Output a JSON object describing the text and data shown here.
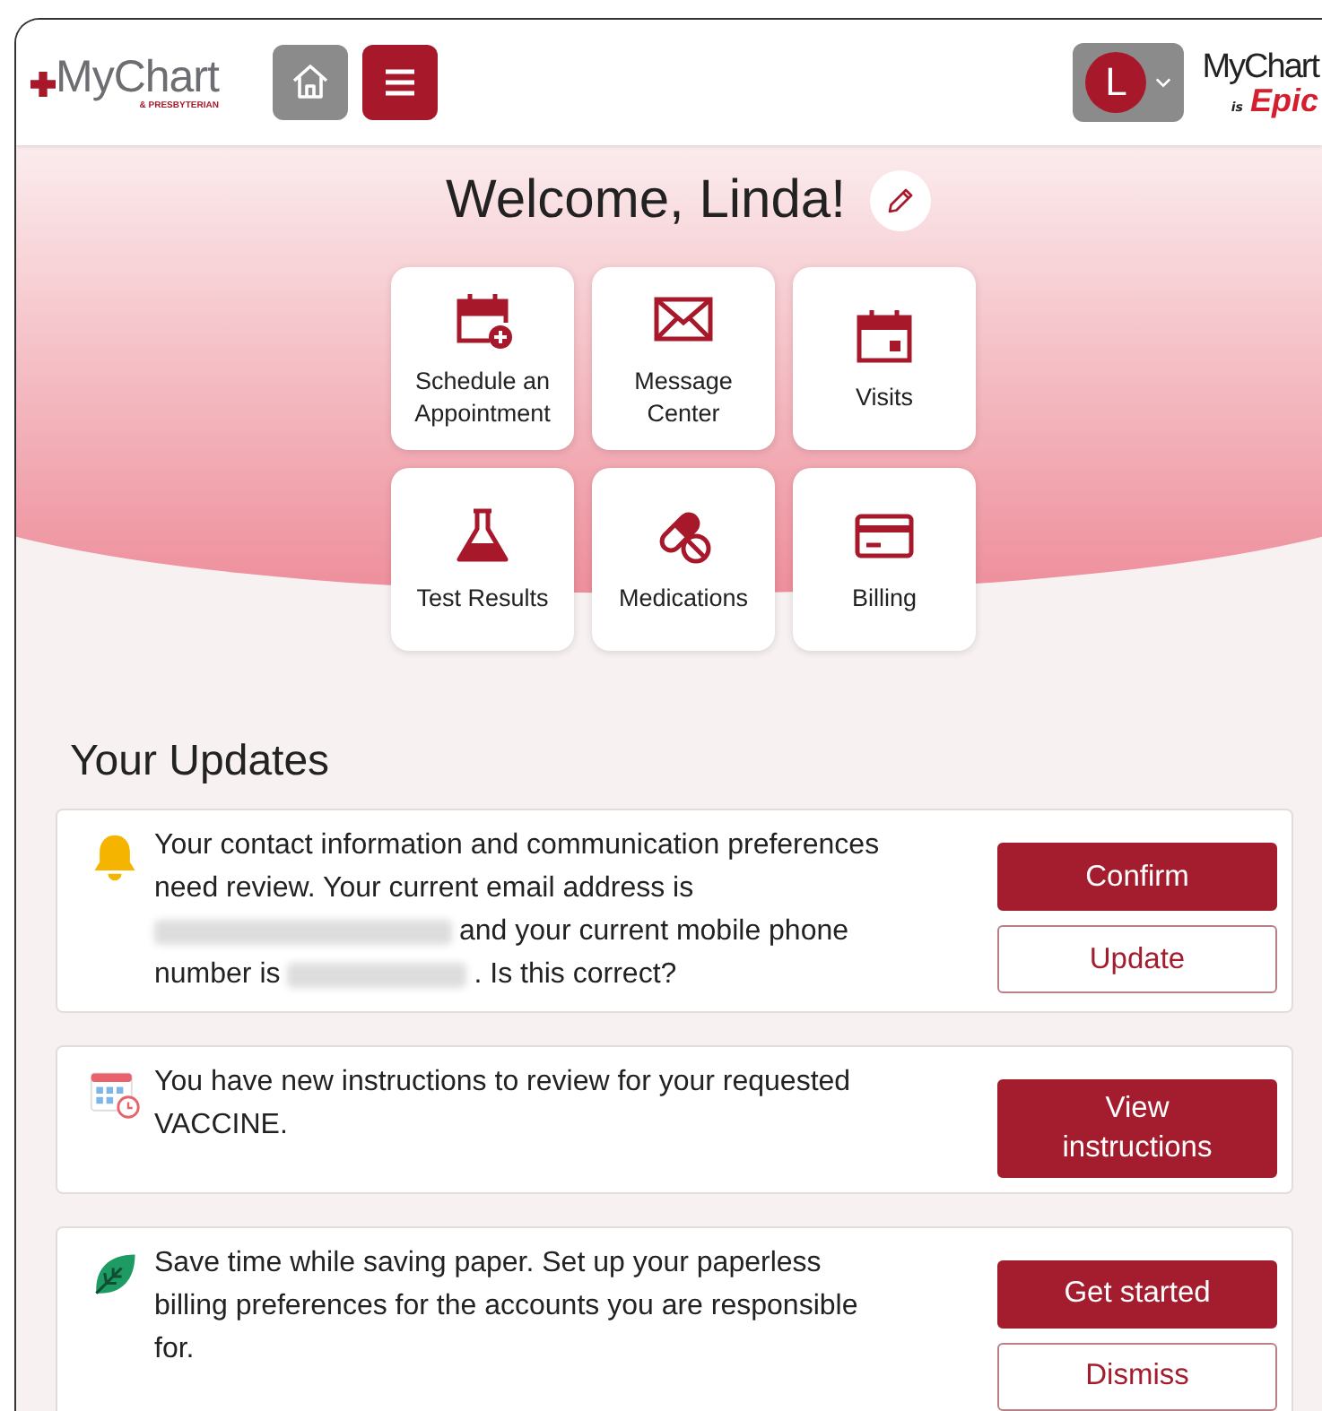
{
  "header": {
    "logo": {
      "name": "MyChart",
      "subtitle": "& PRESBYTERIAN"
    },
    "avatar_initial": "L",
    "brand": {
      "top": "MyChart",
      "is": "is",
      "bottom": "Epic"
    }
  },
  "welcome": "Welcome, Linda!",
  "shortcuts": [
    {
      "kind": "schedule",
      "label": "Schedule an Appointment"
    },
    {
      "kind": "message",
      "label": "Message Center"
    },
    {
      "kind": "visits",
      "label": "Visits"
    },
    {
      "kind": "test",
      "label": "Test Results"
    },
    {
      "kind": "meds",
      "label": "Medications"
    },
    {
      "kind": "billing",
      "label": "Billing"
    }
  ],
  "updates_title": "Your Updates",
  "updates": [
    {
      "kind": "bell",
      "message": [
        [
          {
            "kind": "text",
            "text": "Your contact information and communication preferences"
          }
        ],
        [
          {
            "kind": "text",
            "text": "need review. Your current email address is"
          }
        ],
        [
          {
            "kind": "redacted_email"
          },
          {
            "kind": "text",
            "text": "and your current mobile phone"
          }
        ],
        [
          {
            "kind": "text",
            "text": "number is"
          },
          {
            "kind": "redacted_phone"
          },
          {
            "kind": "text",
            "text": ". Is this correct?"
          }
        ]
      ],
      "buttons": [
        {
          "label": "Confirm",
          "primary": true
        },
        {
          "label": "Update",
          "primary": false
        }
      ]
    },
    {
      "kind": "calendar",
      "message": [
        [
          {
            "kind": "text",
            "text": "You have new instructions to review for your requested"
          }
        ],
        [
          {
            "kind": "text",
            "text": "VACCINE."
          }
        ]
      ],
      "buttons": [
        {
          "label": "View instructions",
          "primary": true
        }
      ]
    },
    {
      "kind": "leaf",
      "message": [
        [
          {
            "kind": "text",
            "text": "Save time while saving paper. Set up your paperless"
          }
        ],
        [
          {
            "kind": "text",
            "text": "billing preferences for the accounts you are responsible"
          }
        ],
        [
          {
            "kind": "text",
            "text": "for."
          }
        ]
      ],
      "buttons": [
        {
          "label": "Get started",
          "primary": true
        },
        {
          "label": "Dismiss",
          "primary": false
        }
      ]
    }
  ]
}
